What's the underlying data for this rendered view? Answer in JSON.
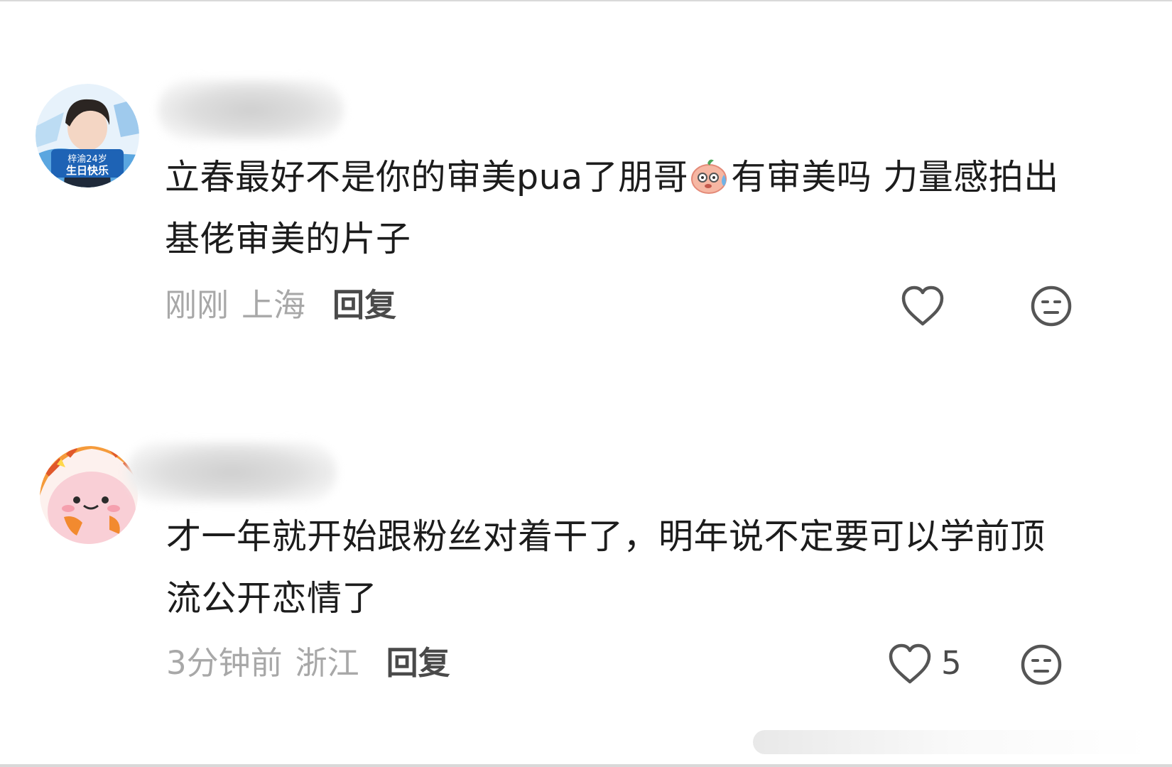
{
  "comments": [
    {
      "username": "",
      "avatar_badge": "梓渝24岁生日快乐",
      "text_part1": "立春最好不是你的审美pua了朋哥",
      "emoji": "sweat-peach-emoji",
      "text_part2": "有审美吗 力量感拍出基佬审美的片子",
      "time": "刚刚",
      "location": "上海",
      "reply_label": "回复",
      "like_count": ""
    },
    {
      "username": "",
      "text": "才一年就开始跟粉丝对着干了，明年说不定要可以学前顶流公开恋情了",
      "time": "3分钟前",
      "location": "浙江",
      "reply_label": "回复",
      "like_count": "5"
    }
  ],
  "icons": {
    "like": "heart-outline-icon",
    "dislike": "meh-face-icon"
  },
  "colors": {
    "text": "#1c1c1c",
    "meta": "#a8a8a8",
    "reply": "#4a4a4a",
    "icon": "#555555"
  }
}
